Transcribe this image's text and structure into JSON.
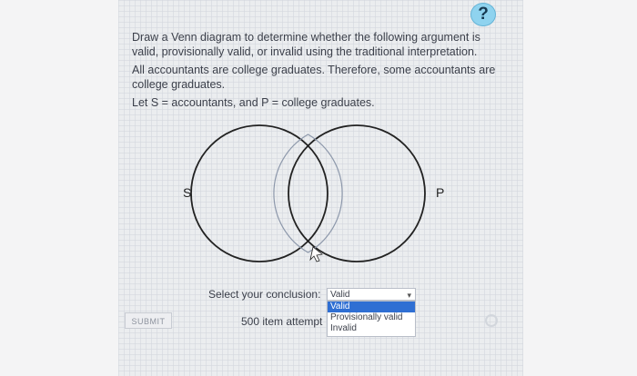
{
  "help_button": {
    "label": "?"
  },
  "prompt": {
    "line1": "Draw a Venn diagram to determine whether the following argument is valid, provisionally valid, or invalid using the traditional interpretation.",
    "argument": "All accountants are college graduates. Therefore, some accountants are college graduates.",
    "definitions": "Let S = accountants, and P = college graduates."
  },
  "venn": {
    "left_label": "S",
    "right_label": "P"
  },
  "conclusion": {
    "label": "Select your conclusion:",
    "selected_value": "Valid",
    "options": [
      "Valid",
      "Provisionally valid",
      "Invalid"
    ]
  },
  "submit": {
    "label": "SUBMIT"
  },
  "attempts": {
    "text": "500 item attempt"
  }
}
